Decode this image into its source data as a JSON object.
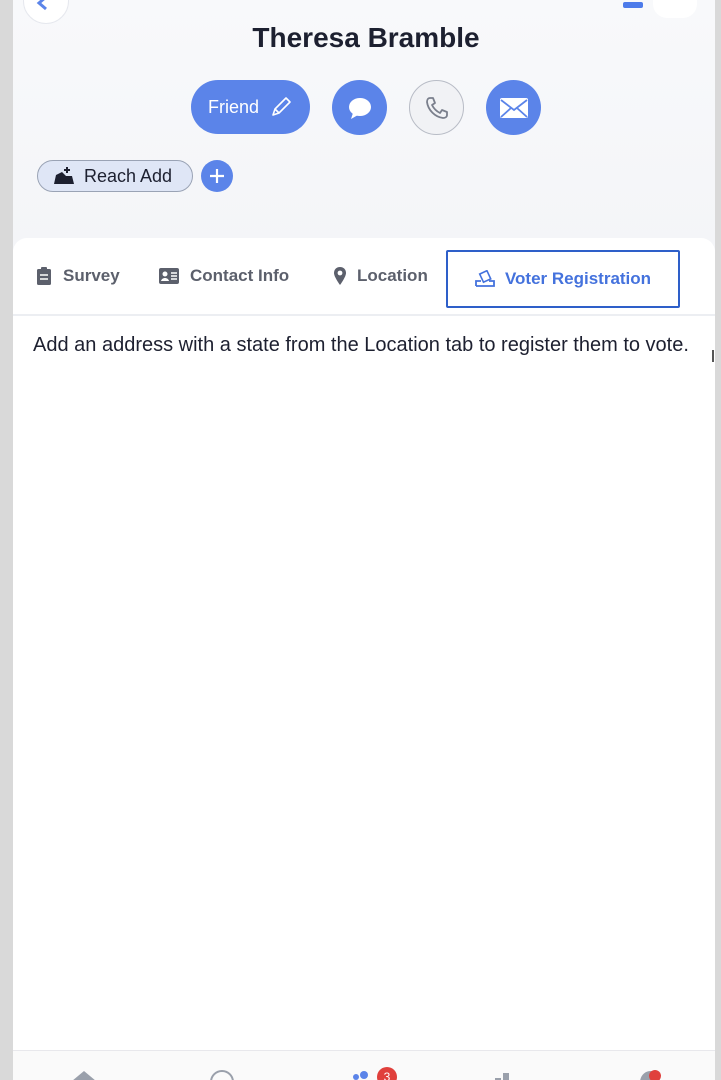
{
  "profile": {
    "name": "Theresa Bramble",
    "friend_label": "Friend",
    "reach_label": "Reach Add"
  },
  "tabs": [
    {
      "label": "Survey",
      "icon": "clipboard-icon"
    },
    {
      "label": "Contact Info",
      "icon": "id-card-icon"
    },
    {
      "label": "Location",
      "icon": "map-pin-icon"
    },
    {
      "label": "Voter Registration",
      "icon": "ballot-icon",
      "active": true
    }
  ],
  "content": {
    "notice": "Add an address with a state from the Location tab to register them to vote."
  },
  "nav": {
    "badge_count": "3"
  },
  "colors": {
    "accent": "#5b84e9",
    "active_border": "#2e5fc9",
    "badge": "#e0403c"
  }
}
